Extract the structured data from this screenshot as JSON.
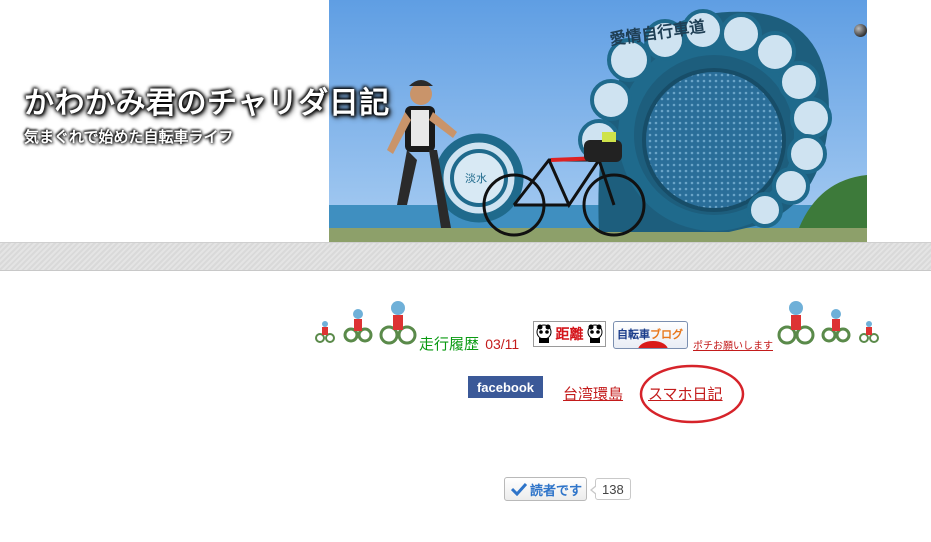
{
  "header": {
    "title": "かわかみ君のチャリダ日記",
    "subtitle": "気まぐれで始めた自転車ライフ",
    "banner_sign_text": "愛情自行車道",
    "banner_small_sign_text": "淡水"
  },
  "banner_row": {
    "track_label": "走行履歴",
    "track_date": "03/11",
    "distance_badge": "距離",
    "blog_badge_prefix": "自転車",
    "blog_badge_suffix": "ブログ",
    "poke_text": "ポチお願いします"
  },
  "links": {
    "facebook": "facebook",
    "taiwan": "台湾環島",
    "smartphone_diary": "スマホ日記"
  },
  "reader": {
    "button_label": "読者です",
    "count": "138"
  },
  "colors": {
    "link_red": "#c31b1b",
    "track_green": "#0a9a12",
    "facebook_blue": "#3b5998",
    "highlight_circle": "#d6232a",
    "reader_blue": "#2e74c9"
  }
}
